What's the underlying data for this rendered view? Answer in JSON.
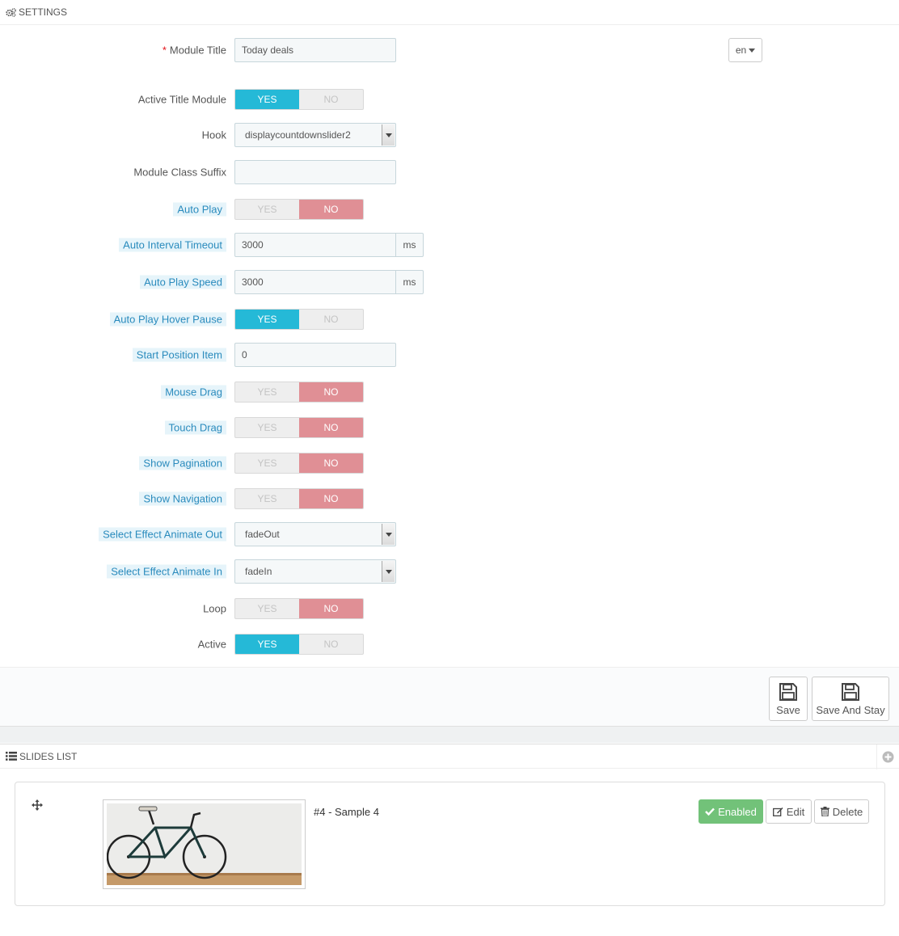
{
  "settings_header": {
    "title": "SETTINGS",
    "icon": "cogs-icon"
  },
  "form": {
    "module_title": {
      "label": "Module Title",
      "required_mark": "*",
      "value": "Today deals",
      "lang": "en"
    },
    "active_title_module": {
      "label": "Active Title Module",
      "yes": "YES",
      "no": "NO",
      "selected": "YES"
    },
    "hook": {
      "label": "Hook",
      "value": "displaycountdownslider2"
    },
    "module_class_suffix": {
      "label": "Module Class Suffix",
      "value": ""
    },
    "auto_play": {
      "label": "Auto Play",
      "yes": "YES",
      "no": "NO",
      "selected": "NO"
    },
    "auto_interval_timeout": {
      "label": "Auto Interval Timeout",
      "value": "3000",
      "unit": "ms"
    },
    "auto_play_speed": {
      "label": "Auto Play Speed",
      "value": "3000",
      "unit": "ms"
    },
    "auto_play_hover_pause": {
      "label": "Auto Play Hover Pause",
      "yes": "YES",
      "no": "NO",
      "selected": "YES"
    },
    "start_position_item": {
      "label": "Start Position Item",
      "value": "0"
    },
    "mouse_drag": {
      "label": "Mouse Drag",
      "yes": "YES",
      "no": "NO",
      "selected": "NO"
    },
    "touch_drag": {
      "label": "Touch Drag",
      "yes": "YES",
      "no": "NO",
      "selected": "NO"
    },
    "show_pagination": {
      "label": "Show Pagination",
      "yes": "YES",
      "no": "NO",
      "selected": "NO"
    },
    "show_navigation": {
      "label": "Show Navigation",
      "yes": "YES",
      "no": "NO",
      "selected": "NO"
    },
    "effect_out": {
      "label": "Select Effect Animate Out",
      "value": "fadeOut"
    },
    "effect_in": {
      "label": "Select Effect Animate In",
      "value": "fadeIn"
    },
    "loop": {
      "label": "Loop",
      "yes": "YES",
      "no": "NO",
      "selected": "NO"
    },
    "active": {
      "label": "Active",
      "yes": "YES",
      "no": "NO",
      "selected": "YES"
    }
  },
  "footer": {
    "save_label": "Save",
    "save_stay_label": "Save And Stay"
  },
  "slides_header": {
    "title": "SLIDES LIST",
    "icon": "list-icon"
  },
  "slides": [
    {
      "title": "#4 - Sample 4",
      "status_label": "Enabled",
      "edit_label": "Edit",
      "delete_label": "Delete"
    }
  ],
  "colors": {
    "yes_active": "#25b9d7",
    "no_active": "#e08f95",
    "enabled": "#72c279",
    "hint_bg": "#e6f4fa",
    "hint_text": "#2a8bbd"
  }
}
